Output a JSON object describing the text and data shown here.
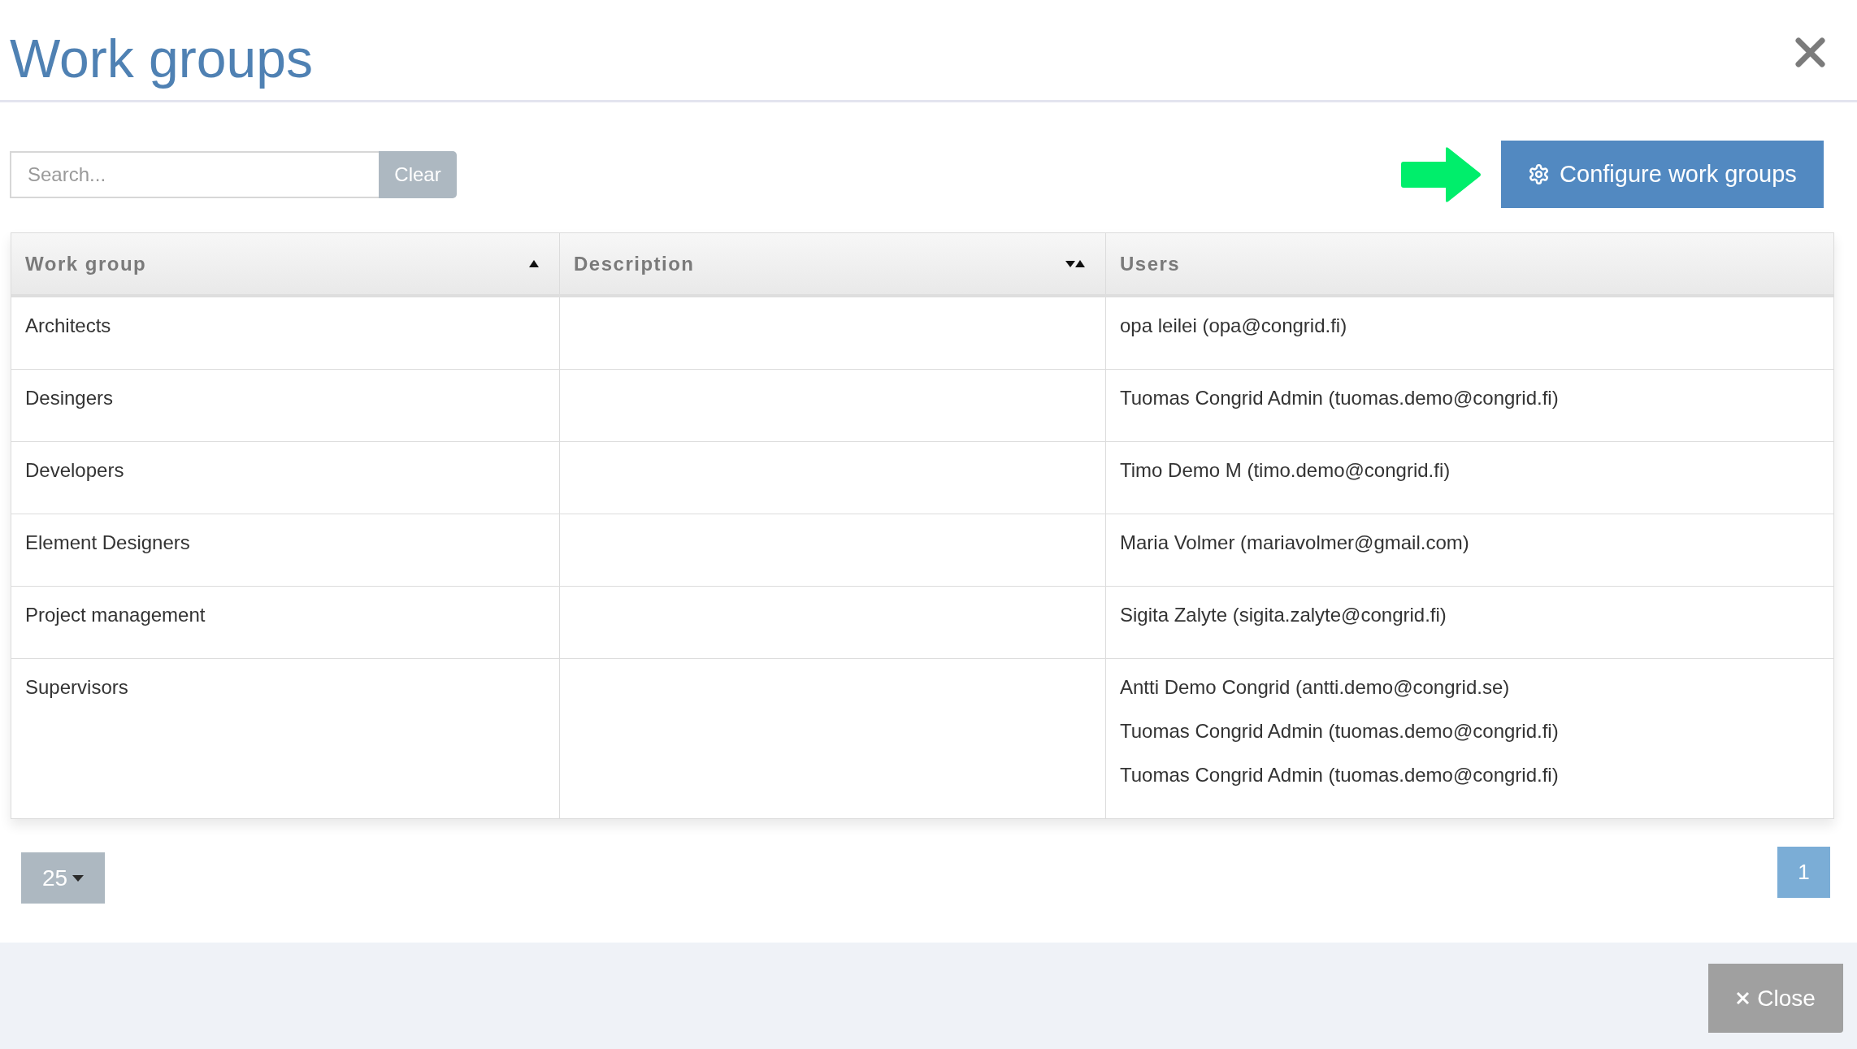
{
  "dialog": {
    "title": "Work groups"
  },
  "toolbar": {
    "search": {
      "placeholder": "Search..."
    },
    "clear_button": "Clear",
    "configure_button": "Configure work groups"
  },
  "table": {
    "columns": [
      {
        "label": "Work group",
        "sortable": true,
        "sorted": true
      },
      {
        "label": "Description",
        "sortable": true,
        "sorted": false
      },
      {
        "label": "Users",
        "sortable": false,
        "sorted": false
      }
    ],
    "rows": [
      {
        "work_group": "Architects",
        "users": [
          "opa leilei (opa@congrid.fi)"
        ]
      },
      {
        "work_group": "Desingers",
        "users": [
          "Tuomas Congrid Admin (tuomas.demo@congrid.fi)"
        ]
      },
      {
        "work_group": "Developers",
        "users": [
          "Timo Demo M (timo.demo@congrid.fi)"
        ]
      },
      {
        "work_group": "Element Designers",
        "users": [
          "Maria Volmer (mariavolmer@gmail.com)"
        ]
      },
      {
        "work_group": "Project management",
        "users": [
          "Sigita Zalyte (sigita.zalyte@congrid.fi)"
        ]
      },
      {
        "work_group": "Supervisors",
        "users": [
          "Antti Demo Congrid (antti.demo@congrid.se)",
          "Tuomas Congrid Admin (tuomas.demo@congrid.fi)",
          "Tuomas Congrid Admin (tuomas.demo@congrid.fi)"
        ]
      }
    ]
  },
  "pagination": {
    "page_size": "25",
    "pages": [
      {
        "label": "1",
        "selected": true
      }
    ]
  },
  "footer": {
    "close_button": "Close"
  }
}
